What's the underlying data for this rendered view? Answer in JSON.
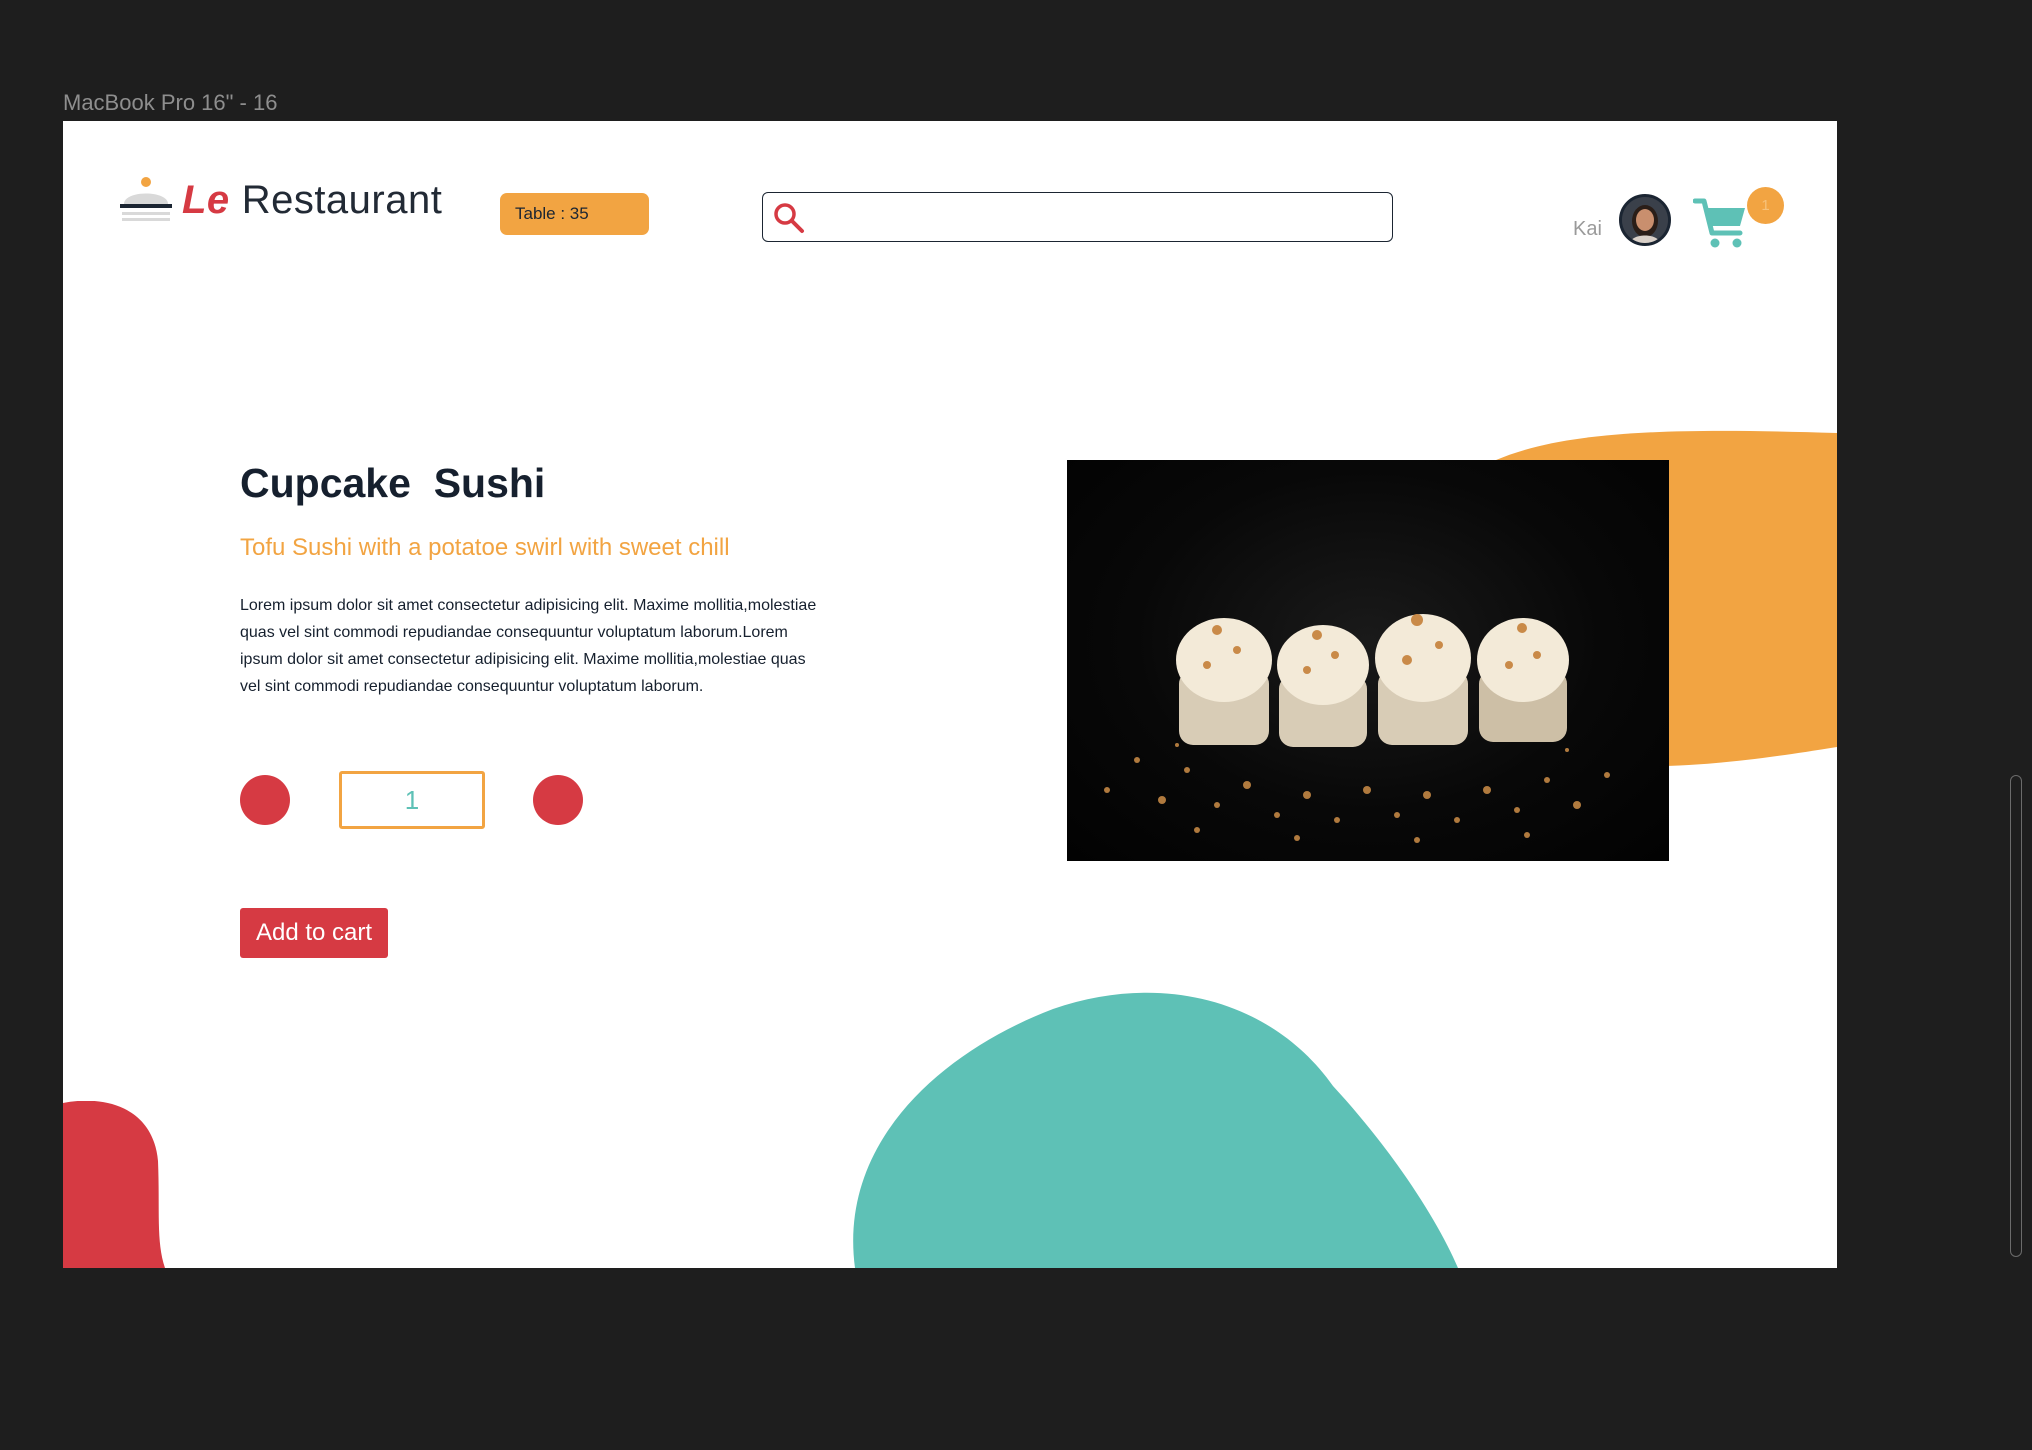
{
  "canvas": {
    "frame_label": "MacBook Pro 16\" - 16"
  },
  "colors": {
    "accent_orange": "#f2a442",
    "accent_red": "#d63a43",
    "accent_teal": "#5ec1b6",
    "text_dark": "#16202e"
  },
  "header": {
    "logo_le": "Le",
    "logo_name": "Restaurant",
    "logo_icon": "cloche-icon",
    "table_label": "Table : 35",
    "search": {
      "value": "",
      "placeholder": "",
      "icon": "search-icon"
    },
    "user_name": "Kai",
    "cart": {
      "icon": "cart-icon",
      "count": "1"
    }
  },
  "product": {
    "title": "Cupcake  Sushi",
    "subtitle": "Tofu Sushi with a potatoe swirl with sweet chill",
    "description": "Lorem ipsum dolor sit amet consectetur adipisicing elit. Maxime mollitia,molestiae quas vel sint commodi repudiandae consequuntur voluptatum laborum.Lorem ipsum dolor sit amet consectetur adipisicing elit. Maxime mollitia,molestiae quas vel sint commodi repudiandae consequuntur voluptatum laborum.",
    "quantity": "1",
    "add_to_cart_label": "Add to cart"
  }
}
